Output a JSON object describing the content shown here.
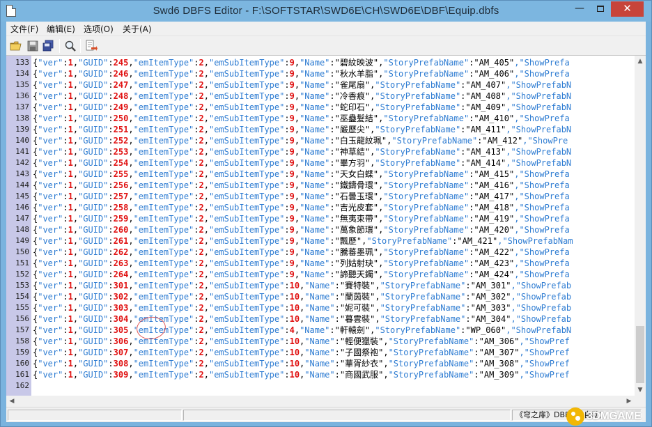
{
  "window": {
    "title": "Swd6 DBFS Editor - F:\\SOFTSTAR\\SWD6E\\CH\\SWD6E\\DBF\\Equip.dbfs",
    "minimize_glyph": "—",
    "close_glyph": "✕"
  },
  "menu": {
    "items": [
      "文件(F)",
      "编辑(E)",
      "选项(O)",
      "关于(A)"
    ]
  },
  "toolbar": {
    "icons": [
      "open-folder-icon",
      "save-icon",
      "save-all-icon",
      "find-icon",
      "export-icon"
    ]
  },
  "editor": {
    "rows": [
      {
        "num": "133",
        "guid": "245",
        "sub": "9",
        "name": "碧紋映波",
        "prefab": "AM_405",
        "tail": ",\"ShowPrefa"
      },
      {
        "num": "134",
        "guid": "246",
        "sub": "9",
        "name": "秋水羊脂",
        "prefab": "AM_406",
        "tail": ",\"ShowPrefa"
      },
      {
        "num": "135",
        "guid": "247",
        "sub": "9",
        "name": "雀尾扇",
        "prefab": "AM_407",
        "tail": ",\"ShowPrefabN"
      },
      {
        "num": "136",
        "guid": "248",
        "sub": "9",
        "name": "冷香痕",
        "prefab": "AM_408",
        "tail": ",\"ShowPrefabN"
      },
      {
        "num": "137",
        "guid": "249",
        "sub": "9",
        "name": "蛇印石",
        "prefab": "AM_409",
        "tail": ",\"ShowPrefabN"
      },
      {
        "num": "138",
        "guid": "250",
        "sub": "9",
        "name": "巫蠱髮結",
        "prefab": "AM_410",
        "tail": ",\"ShowPrefa"
      },
      {
        "num": "139",
        "guid": "251",
        "sub": "9",
        "name": "嚴歷尖",
        "prefab": "AM_411",
        "tail": ",\"ShowPrefabN"
      },
      {
        "num": "140",
        "guid": "252",
        "sub": "9",
        "name": "白玉龍紋珮",
        "prefab": "AM_412",
        "tail": ",\"ShowPre"
      },
      {
        "num": "141",
        "guid": "253",
        "sub": "9",
        "name": "神草結",
        "prefab": "AM_413",
        "tail": ",\"ShowPrefabN"
      },
      {
        "num": "142",
        "guid": "254",
        "sub": "9",
        "name": "畢方羽",
        "prefab": "AM_414",
        "tail": ",\"ShowPrefabN"
      },
      {
        "num": "143",
        "guid": "255",
        "sub": "9",
        "name": "天女白蝶",
        "prefab": "AM_415",
        "tail": ",\"ShowPrefa"
      },
      {
        "num": "144",
        "guid": "256",
        "sub": "9",
        "name": "鐵鑄骨環",
        "prefab": "AM_416",
        "tail": ",\"ShowPrefa"
      },
      {
        "num": "145",
        "guid": "257",
        "sub": "9",
        "name": "石曇玉環",
        "prefab": "AM_417",
        "tail": ",\"ShowPrefa"
      },
      {
        "num": "146",
        "guid": "258",
        "sub": "9",
        "name": "吉光皮套",
        "prefab": "AM_418",
        "tail": ",\"ShowPrefa"
      },
      {
        "num": "147",
        "guid": "259",
        "sub": "9",
        "name": "無夷束帶",
        "prefab": "AM_419",
        "tail": ",\"ShowPrefa"
      },
      {
        "num": "148",
        "guid": "260",
        "sub": "9",
        "name": "萬象節環",
        "prefab": "AM_420",
        "tail": ",\"ShowPrefa"
      },
      {
        "num": "149",
        "guid": "261",
        "sub": "9",
        "name": "飄歷",
        "prefab": "AM_421",
        "tail": ",\"ShowPrefabNam"
      },
      {
        "num": "150",
        "guid": "262",
        "sub": "9",
        "name": "騰蕃墨珮",
        "prefab": "AM_422",
        "tail": ",\"ShowPrefa"
      },
      {
        "num": "151",
        "guid": "263",
        "sub": "9",
        "name": "列姑射玦",
        "prefab": "AM_423",
        "tail": ",\"ShowPrefa"
      },
      {
        "num": "152",
        "guid": "264",
        "sub": "9",
        "name": "諦聽天鐲",
        "prefab": "AM_424",
        "tail": ",\"ShowPrefa"
      },
      {
        "num": "153",
        "guid": "301",
        "sub": "10",
        "name": "賽特裝",
        "prefab": "AM_301",
        "tail": ",\"ShowPrefab"
      },
      {
        "num": "154",
        "guid": "302",
        "sub": "10",
        "name": "蘭茵裝",
        "prefab": "AM_302",
        "tail": ",\"ShowPrefab"
      },
      {
        "num": "155",
        "guid": "303",
        "sub": "10",
        "name": "妮可裝",
        "prefab": "AM_303",
        "tail": ",\"ShowPrefab"
      },
      {
        "num": "156",
        "guid": "304",
        "sub": "10",
        "name": "暮雲裝",
        "prefab": "AM_304",
        "tail": ",\"ShowPrefab"
      },
      {
        "num": "157",
        "guid": "305",
        "sub": "4",
        "name": "軒轅劍",
        "prefab": "WP_060",
        "tail": ",\"ShowPrefabN"
      },
      {
        "num": "158",
        "guid": "306",
        "sub": "10",
        "name": "輕便獵裝",
        "prefab": "AM_306",
        "tail": ",\"ShowPref"
      },
      {
        "num": "159",
        "guid": "307",
        "sub": "10",
        "name": "子國祭袍",
        "prefab": "AM_307",
        "tail": ",\"ShowPref"
      },
      {
        "num": "160",
        "guid": "308",
        "sub": "10",
        "name": "華胥紗衣",
        "prefab": "AM_308",
        "tail": ",\"ShowPref"
      },
      {
        "num": "161",
        "guid": "309",
        "sub": "10",
        "name": "商國武服",
        "prefab": "AM_309",
        "tail": ",\"ShowPref"
      },
      {
        "num": "162",
        "guid": "",
        "sub": "",
        "name": "",
        "prefab": "",
        "tail": ""
      }
    ]
  },
  "statusbar": {
    "panel1": "",
    "panel2": "",
    "panel3": "《穹之扉》DBF",
    "panel4": "(自动)"
  },
  "watermark": {
    "text": "3DMGAME"
  }
}
